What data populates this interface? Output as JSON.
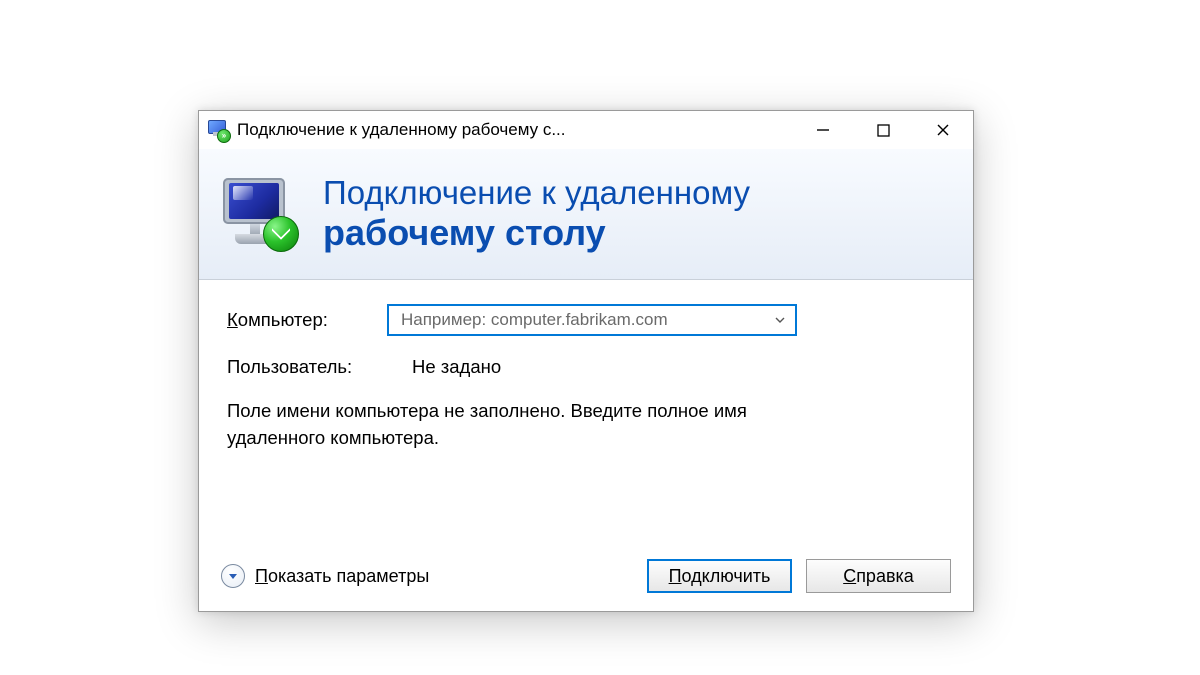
{
  "window": {
    "title": "Подключение к удаленному рабочему с..."
  },
  "banner": {
    "line1": "Подключение к удаленному",
    "line2": "рабочему столу"
  },
  "form": {
    "computer_label_first": "К",
    "computer_label_rest": "омпьютер:",
    "computer_placeholder": "Например: computer.fabrikam.com",
    "computer_value": "",
    "user_label": "Пользователь:",
    "user_value": "Не задано",
    "hint": "Поле имени компьютера не заполнено. Введите полное имя удаленного компьютера."
  },
  "footer": {
    "show_options_first": "П",
    "show_options_rest": "оказать параметры",
    "connect_first": "П",
    "connect_rest": "одключить",
    "help_first": "С",
    "help_rest": "правка"
  }
}
